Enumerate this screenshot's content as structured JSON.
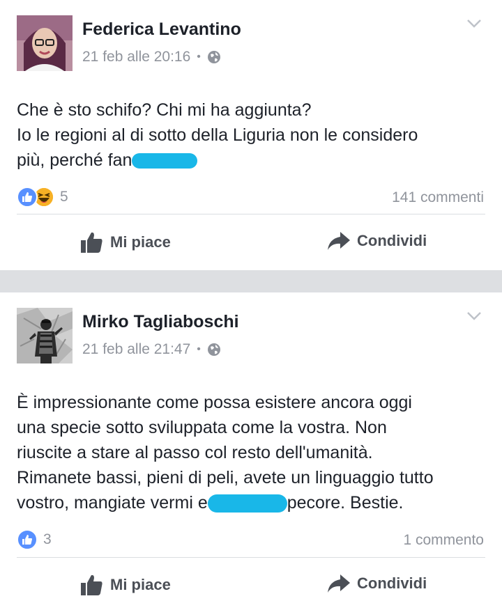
{
  "posts": [
    {
      "author": "Federica Levantino",
      "timestamp": "21 feb alle 20:16",
      "separator": "•",
      "privacy_icon": "globe-icon",
      "text_lines": [
        "Che è sto schifo? Chi mi ha aggiunta?",
        "Io le regioni al di sotto della Liguria non le considero",
        "più, perché fan"
      ],
      "reactions": [
        "like",
        "haha"
      ],
      "reactions_count": "5",
      "comments": "141 commenti",
      "like_label": "Mi piace",
      "share_label": "Condividi"
    },
    {
      "author": "Mirko Tagliaboschi",
      "timestamp": "21 feb alle 21:47",
      "separator": "•",
      "privacy_icon": "globe-icon",
      "text_lines": [
        "È impressionante come possa esistere ancora oggi",
        "una specie sotto sviluppata come la vostra. Non",
        "riuscite a stare al passo col resto dell'umanità.",
        "Rimanete bassi, pieni di peli, avete un linguaggio tutto",
        "vostro, mangiate vermi e",
        "pecore. Bestie."
      ],
      "reactions": [
        "like"
      ],
      "reactions_count": "3",
      "comments": "1 commento",
      "like_label": "Mi piace",
      "share_label": "Condividi"
    }
  ],
  "colors": {
    "author": "#1d2129",
    "meta": "#90949c",
    "like_blue": "#5890ff",
    "haha_yellow": "#f7b125",
    "redaction": "#19b7e8",
    "separator_band": "#dddfe2"
  }
}
